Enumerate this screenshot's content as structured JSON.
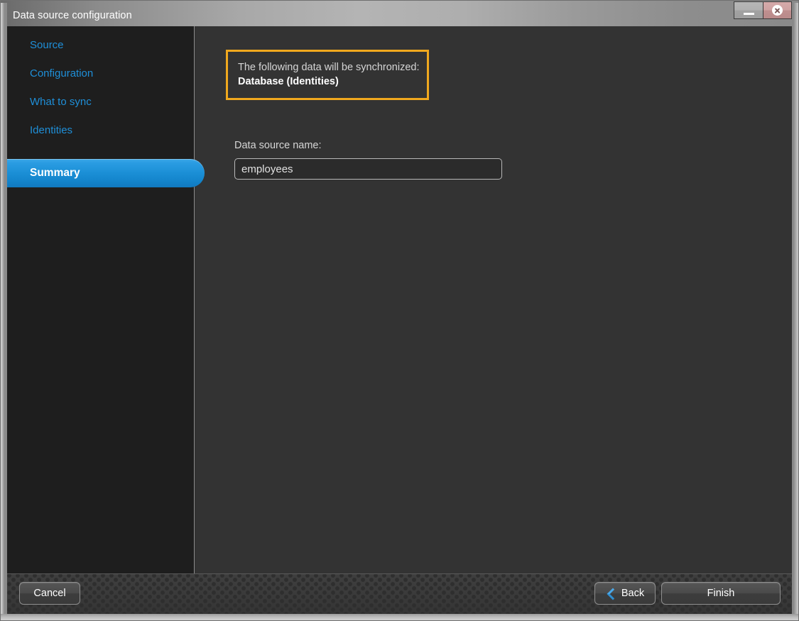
{
  "window": {
    "title": "Data source configuration",
    "controls": {
      "minimize_name": "minimize-icon",
      "close_name": "close-icon"
    }
  },
  "sidebar": {
    "items": [
      {
        "label": "Source",
        "active": false
      },
      {
        "label": "Configuration",
        "active": false
      },
      {
        "label": "What to sync",
        "active": false
      },
      {
        "label": "Identities",
        "active": false
      },
      {
        "label": "Summary",
        "active": true
      }
    ]
  },
  "content": {
    "info_box": {
      "line1": "The following data will be synchronized:",
      "line2": "Database (Identities)",
      "border_color": "#f0a81e"
    },
    "field": {
      "label": "Data source name:",
      "value": "employees",
      "placeholder": ""
    }
  },
  "footer": {
    "cancel_label": "Cancel",
    "back_label": "Back",
    "finish_label": "Finish",
    "back_icon": "chevron-left-icon"
  },
  "colors": {
    "accent_blue": "#1f8fd8",
    "highlight_orange": "#f0a81e",
    "sidebar_bg": "#1e1e1e",
    "content_bg": "#333333"
  }
}
